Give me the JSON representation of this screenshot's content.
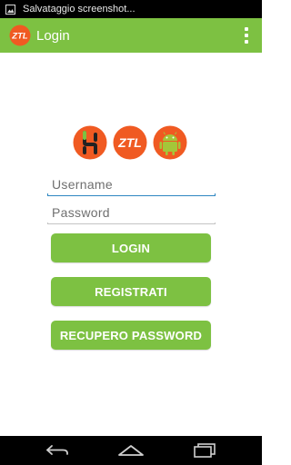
{
  "statusbar": {
    "notification_icon": "image-icon",
    "text": "Salvataggio screenshot..."
  },
  "actionbar": {
    "logo_text": "ZTL",
    "title": "Login",
    "overflow_icon": "overflow-menu-icon"
  },
  "logos": [
    {
      "name": "h-app-logo",
      "color": "#f05a22"
    },
    {
      "name": "ztl-logo",
      "text": "ZTL",
      "color": "#f05a22"
    },
    {
      "name": "android-logo",
      "color": "#f05a22"
    }
  ],
  "form": {
    "username_placeholder": "Username",
    "username_value": "",
    "password_placeholder": "Password",
    "password_value": ""
  },
  "buttons": {
    "login": "LOGIN",
    "register": "REGISTRATI",
    "recover": "RECUPERO PASSWORD"
  },
  "navbar": {
    "back_icon": "back-icon",
    "home_icon": "home-icon",
    "recents_icon": "recents-icon"
  },
  "colors": {
    "accent": "#7dc142",
    "logo_orange": "#f05a22",
    "focus_blue": "#2e86c1"
  }
}
